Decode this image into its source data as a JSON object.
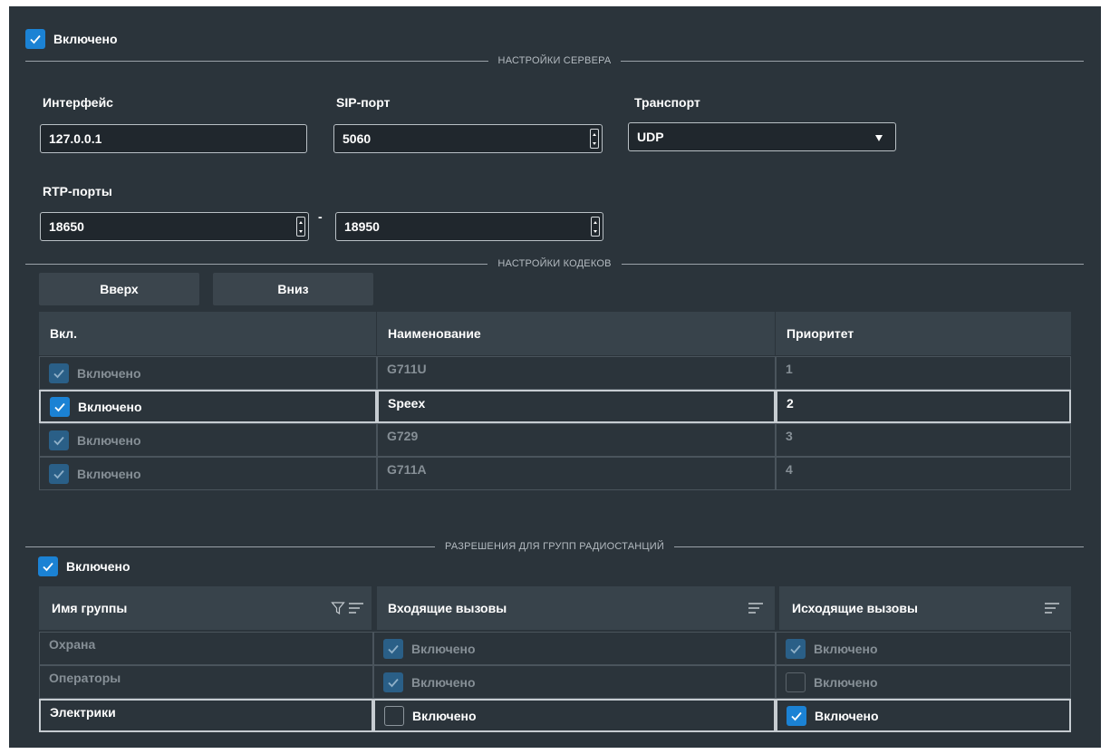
{
  "enabled_label": "Включено",
  "server_section": {
    "title": "НАСТРОЙКИ СЕРВЕРА",
    "interface_label": "Интерфейс",
    "interface_value": "127.0.0.1",
    "sip_port_label": "SIP-порт",
    "sip_port_value": "5060",
    "transport_label": "Транспорт",
    "transport_value": "UDP",
    "rtp_label": "RTP-порты",
    "rtp_from": "18650",
    "rtp_dash": "-",
    "rtp_to": "18950"
  },
  "codec_section": {
    "title": "НАСТРОЙКИ КОДЕКОВ",
    "up_label": "Вверх",
    "down_label": "Вниз",
    "columns": [
      "Вкл.",
      "Наименование",
      "Приоритет"
    ],
    "rows": [
      {
        "enabled": "Включено",
        "name": "G711U",
        "priority": "1"
      },
      {
        "enabled": "Включено",
        "name": "Speex",
        "priority": "2"
      },
      {
        "enabled": "Включено",
        "name": "G729",
        "priority": "3"
      },
      {
        "enabled": "Включено",
        "name": "G711A",
        "priority": "4"
      }
    ]
  },
  "groups_section": {
    "title": "РАЗРЕШЕНИЯ ДЛЯ ГРУПП РАДИОСТАНЦИЙ",
    "enabled_label": "Включено",
    "columns": [
      "Имя группы",
      "Входящие вызовы",
      "Исходящие вызовы"
    ],
    "rows": [
      {
        "name": "Охрана",
        "incoming": "Включено",
        "outgoing": "Включено"
      },
      {
        "name": "Операторы",
        "incoming": "Включено",
        "outgoing": "Включено"
      },
      {
        "name": "Электрики",
        "incoming": "Включено",
        "outgoing": "Включено"
      }
    ]
  },
  "colors": {
    "panel_bg": "#2b343b",
    "accent": "#1b82d4",
    "header_bg": "#38434b"
  }
}
